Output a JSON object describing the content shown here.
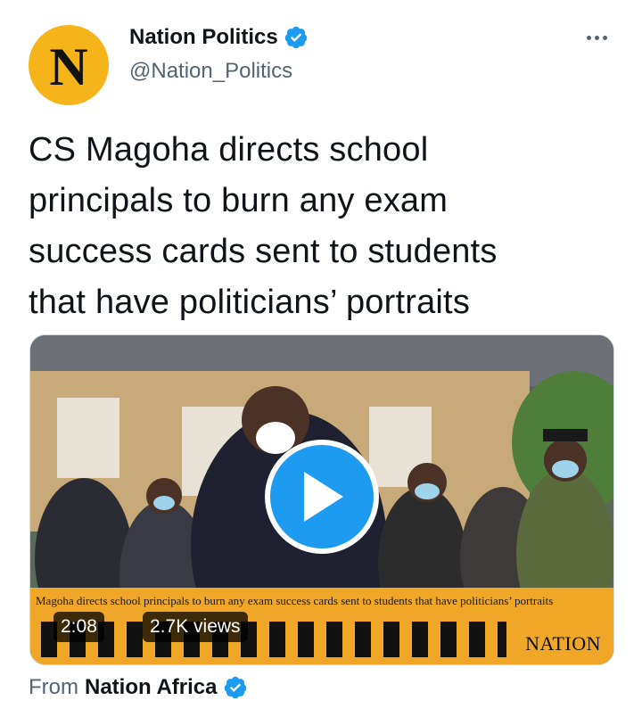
{
  "author": {
    "avatar_letter": "N",
    "display_name": "Nation Politics",
    "handle": "@Nation_Politics",
    "verified": true,
    "avatar_color": "#f4b41a"
  },
  "tweet": {
    "text_lines": [
      "CS Magoha directs school",
      "principals to burn any exam",
      "success cards sent to students",
      "that have politicians’ portraits"
    ]
  },
  "media": {
    "type": "video",
    "duration": "2:08",
    "views": "2.7K views",
    "caption": "Magoha directs school principals to burn any exam success cards sent to students that have politicians’ portraits",
    "brand": "NATION",
    "play_color": "#1d9bf0"
  },
  "source": {
    "prefix": "From",
    "name": "Nation Africa",
    "verified": true
  },
  "icons": {
    "verified": "verified-badge-icon",
    "more": "more-dots-icon",
    "play": "play-icon"
  }
}
